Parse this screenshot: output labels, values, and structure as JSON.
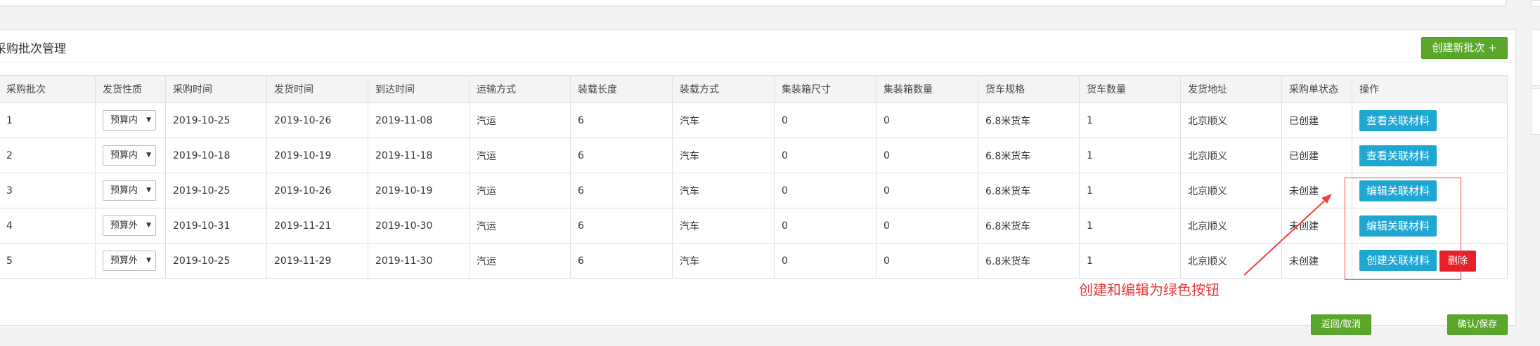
{
  "panel": {
    "title": "采购批次管理",
    "create_batch_label": "创建新批次 +"
  },
  "table": {
    "headers": [
      "采购批次",
      "发货性质",
      "采购时间",
      "发货时间",
      "到达时间",
      "运输方式",
      "装载长度",
      "装载方式",
      "集装箱尺寸",
      "集装箱数量",
      "货车规格",
      "货车数量",
      "发货地址",
      "采购单状态",
      "操作"
    ],
    "rows": [
      {
        "batch": "1",
        "nature": "预算内",
        "purchase_time": "2019-10-25",
        "ship_time": "2019-10-26",
        "arrive_time": "2019-11-08",
        "transport": "汽运",
        "length": "6",
        "load_mode": "汽车",
        "container_size": "0",
        "container_qty": "0",
        "truck_spec": "6.8米货车",
        "truck_qty": "1",
        "address": "北京顺义",
        "status": "已创建",
        "action": "查看关联材料"
      },
      {
        "batch": "2",
        "nature": "预算内",
        "purchase_time": "2019-10-18",
        "ship_time": "2019-10-19",
        "arrive_time": "2019-11-18",
        "transport": "汽运",
        "length": "6",
        "load_mode": "汽车",
        "container_size": "0",
        "container_qty": "0",
        "truck_spec": "6.8米货车",
        "truck_qty": "1",
        "address": "北京顺义",
        "status": "已创建",
        "action": "查看关联材料"
      },
      {
        "batch": "3",
        "nature": "预算内",
        "purchase_time": "2019-10-25",
        "ship_time": "2019-10-26",
        "arrive_time": "2019-10-19",
        "transport": "汽运",
        "length": "6",
        "load_mode": "汽车",
        "container_size": "0",
        "container_qty": "0",
        "truck_spec": "6.8米货车",
        "truck_qty": "1",
        "address": "北京顺义",
        "status": "未创建",
        "action": "编辑关联材料"
      },
      {
        "batch": "4",
        "nature": "预算外",
        "purchase_time": "2019-10-31",
        "ship_time": "2019-11-21",
        "arrive_time": "2019-10-30",
        "transport": "汽运",
        "length": "6",
        "load_mode": "汽车",
        "container_size": "0",
        "container_qty": "0",
        "truck_spec": "6.8米货车",
        "truck_qty": "1",
        "address": "北京顺义",
        "status": "未创建",
        "action": "编辑关联材料"
      },
      {
        "batch": "5",
        "nature": "预算外",
        "purchase_time": "2019-10-25",
        "ship_time": "2019-11-29",
        "arrive_time": "2019-11-30",
        "transport": "汽运",
        "length": "6",
        "load_mode": "汽车",
        "container_size": "0",
        "container_qty": "0",
        "truck_spec": "6.8米货车",
        "truck_qty": "1",
        "address": "北京顺义",
        "status": "未创建",
        "action": "创建关联材料",
        "delete_label": "删除"
      }
    ]
  },
  "footer": {
    "back_label": "返回/取消",
    "confirm_label": "确认/保存"
  },
  "annotation": {
    "text": "创建和编辑为绿色按钮"
  },
  "colors": {
    "green": "#5aa82a",
    "blue": "#1fa7d2",
    "red": "#e8202a",
    "annotation": "#e53a3a"
  }
}
